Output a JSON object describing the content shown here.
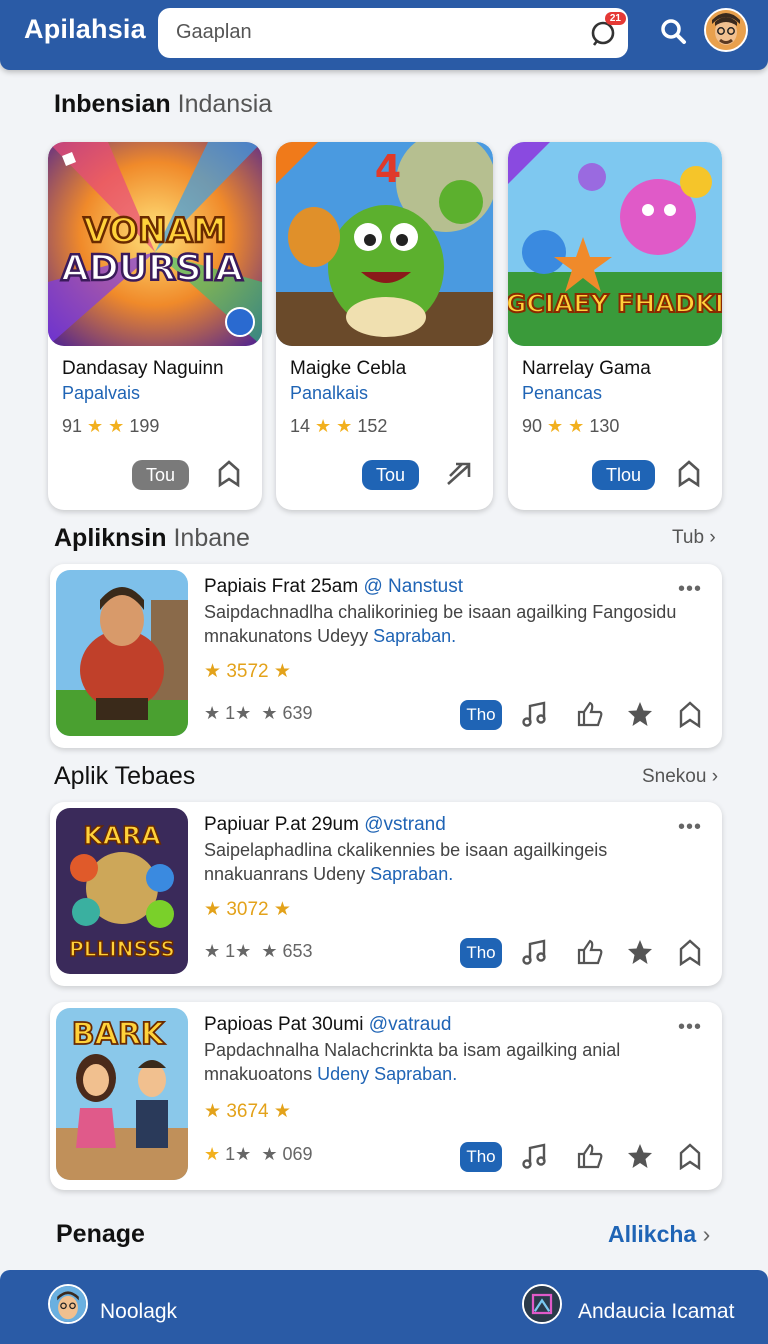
{
  "app": {
    "title": "Apilahsia"
  },
  "search": {
    "placeholder": "Gaaplan",
    "badge": "21"
  },
  "featured": {
    "title": "Inbensian",
    "subtitle": "Indansia",
    "cards": [
      {
        "art_text": [
          "VONAM",
          "ADURSIA"
        ],
        "name": "Dandasay Naguinn",
        "developer": "Papalvais",
        "rating_left": "91",
        "rating_right": "199",
        "button": "Tou"
      },
      {
        "art_text": [
          "4"
        ],
        "name": "Maigke Cebla",
        "developer": "Panalkais",
        "rating_left": "14",
        "rating_right": "152",
        "button": "Tou"
      },
      {
        "art_text": [
          "GCIAEY FHADKI"
        ],
        "name": "Narrelay Gama",
        "developer": "Penancas",
        "rating_left": "90",
        "rating_right": "130",
        "button": "Tlou"
      }
    ]
  },
  "section2": {
    "title": "Apliknsin",
    "subtitle": "Inbane",
    "link": "Tub"
  },
  "section3": {
    "title": "Aplik Tebaes",
    "link": "Snekou"
  },
  "list": [
    {
      "title": "Papiais Frat 25am",
      "handle": "@ Nanstust",
      "desc_line1": "Saipdachnadlha chalikorinieg be isaan agailking Fangosidu",
      "desc_line2_plain": "mnakunatons Udeyy",
      "desc_line2_link": "Sapraban.",
      "score": "3572",
      "meta_left": "1",
      "meta_right": "639",
      "button": "Tho",
      "art_text": []
    },
    {
      "title": "Papiuar P.at 29um",
      "handle": "@vstrand",
      "desc_line1": "Saipelaphadlina ckalikennies be isaan agailkingeis",
      "desc_line2_plain": "nnakuanrans Udeny",
      "desc_line2_link": "Sapraban.",
      "score": "3072",
      "meta_left": "1",
      "meta_right": "653",
      "button": "Tho",
      "art_text": [
        "KARA",
        "PLLINSSS"
      ]
    },
    {
      "title": "Papioas Pat 30umi",
      "handle": "@vatraud",
      "desc_line1": "Papdachnalha Nalachcrinkta ba isam agailking anial",
      "desc_line2_plain": "mnakuoatons",
      "desc_line2_link": "Udeny Sapraban.",
      "score": "3674",
      "meta_left": "1",
      "meta_right": "069",
      "button": "Tho",
      "art_text": [
        "BARK"
      ]
    }
  ],
  "bottom": {
    "title": "Penage",
    "link": "Allikcha"
  },
  "bottombar": {
    "left_label": "Noolagk",
    "right_label": "Andaucia Icamat"
  },
  "icons": {
    "search": "search-icon",
    "mic": "mic-icon",
    "share": "share-icon",
    "bookmark": "bookmark-icon",
    "music": "music-icon",
    "like": "thumbs-up-icon",
    "star": "star-icon",
    "more": "more-icon"
  },
  "colors": {
    "primary": "#2a5ba6",
    "link": "#1f64b5",
    "star": "#f2b01e",
    "badge": "#e53935"
  }
}
